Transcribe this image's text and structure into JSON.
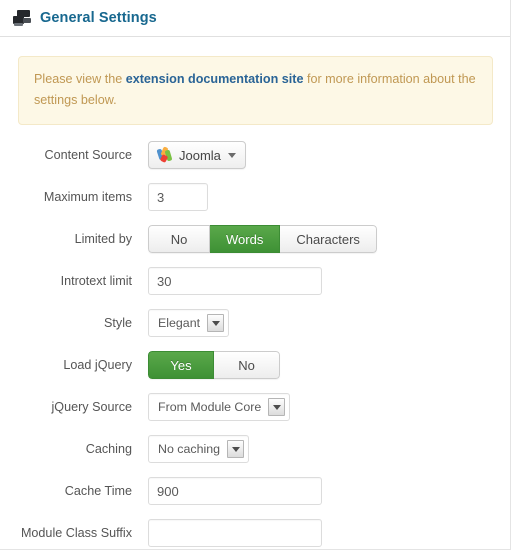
{
  "header": {
    "title": "General Settings",
    "icon": "modules-icon"
  },
  "alert": {
    "text_before": "Please view the ",
    "link_text": "extension documentation site",
    "text_after": " for more information about the settings below.",
    "background_color": "#fdf8e6",
    "border_color": "#f4e9c8",
    "text_color": "#c09853",
    "link_color": "#2a6496"
  },
  "form": {
    "accent_color": "#3e9135",
    "rows": [
      {
        "label": "Content Source",
        "type": "dropdown-button",
        "value": "Joomla",
        "icon": "joomla-logo-icon"
      },
      {
        "label": "Maximum items",
        "type": "text",
        "value": "3",
        "placeholder": ""
      },
      {
        "label": "Limited by",
        "type": "button-group",
        "options": [
          "No",
          "Words",
          "Characters"
        ],
        "selected": "Words"
      },
      {
        "label": "Introtext limit",
        "type": "text",
        "value": "30",
        "placeholder": ""
      },
      {
        "label": "Style",
        "type": "select",
        "value": "Elegant"
      },
      {
        "label": "Load jQuery",
        "type": "button-group",
        "options": [
          "Yes",
          "No"
        ],
        "selected": "Yes"
      },
      {
        "label": "jQuery Source",
        "type": "select",
        "value": "From Module Core"
      },
      {
        "label": "Caching",
        "type": "select",
        "value": "No caching"
      },
      {
        "label": "Cache Time",
        "type": "text",
        "value": "900",
        "placeholder": ""
      },
      {
        "label": "Module Class Suffix",
        "type": "text",
        "value": "",
        "placeholder": ""
      }
    ]
  }
}
